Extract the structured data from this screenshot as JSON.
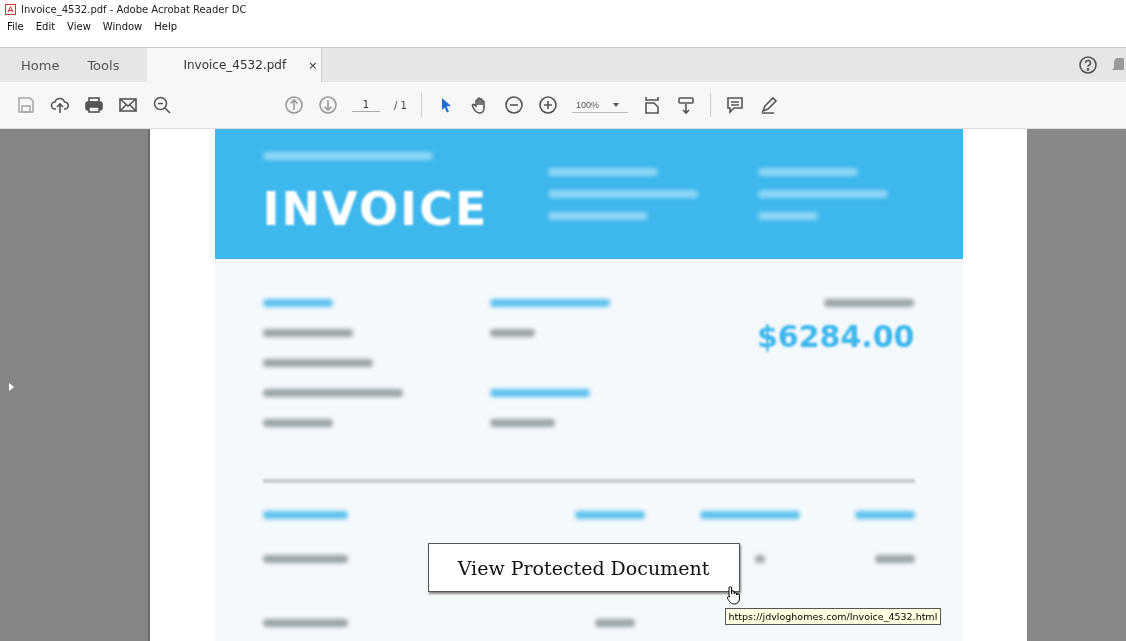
{
  "window": {
    "title": "Invoice_4532.pdf - Adobe Acrobat Reader DC"
  },
  "menu": [
    "File",
    "Edit",
    "View",
    "Window",
    "Help"
  ],
  "tabs": [
    {
      "label": "Home",
      "selected": false
    },
    {
      "label": "Tools",
      "selected": false
    },
    {
      "label": "Invoice_4532.pdf",
      "selected": true,
      "close": "×"
    }
  ],
  "toolbar": {
    "page": "1",
    "pages": "/ 1",
    "zoom": "100%"
  },
  "document": {
    "heading": "INVOICE",
    "total": "$6284.00"
  },
  "link_button": {
    "label": "View Protected Document"
  },
  "tooltip": {
    "text": "https://jdvloghomes.com/Invoice_4532.html"
  }
}
